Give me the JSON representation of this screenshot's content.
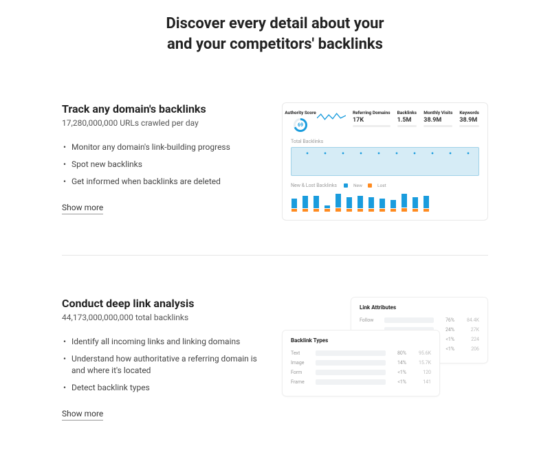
{
  "hero": {
    "line1": "Discover every detail about your",
    "line2": "and your competitors' backlinks"
  },
  "section1": {
    "title": "Track any domain's backlinks",
    "subtitle": "17,280,000,000 URLs crawled per day",
    "bullets": [
      "Monitor any domain's link-building progress",
      "Spot new backlinks",
      "Get informed when backlinks are deleted"
    ],
    "show_more": "Show more",
    "card": {
      "authority_label": "Authority Score",
      "authority_value": "69",
      "stats": [
        {
          "label": "Referring Domains",
          "value": "17K"
        },
        {
          "label": "Backlinks",
          "value": "1.5M"
        },
        {
          "label": "Monthly Visits",
          "value": "38.9M"
        },
        {
          "label": "Keywords",
          "value": "38.9M"
        }
      ],
      "total_label": "Total Backlinks",
      "newlost_label": "New & Lost Backlinks",
      "legend_new": "New",
      "legend_lost": "Lost"
    }
  },
  "section2": {
    "title": "Conduct deep link analysis",
    "subtitle": "44,173,000,000,000 total backlinks",
    "bullets": [
      "Identify all incoming links and linking domains",
      "Understand how authoritative a referring domain is and where it's located",
      "Detect backlink types"
    ],
    "show_more": "Show more",
    "link_attributes": {
      "title": "Link Attributes",
      "rows": [
        {
          "label": "Follow",
          "pct": "76%",
          "count": "84.4K",
          "fill": 76,
          "green": true
        },
        {
          "label": "",
          "pct": "24%",
          "count": "27K",
          "fill": 24
        },
        {
          "label": "",
          "pct": "<1%",
          "count": "224",
          "fill": 2
        },
        {
          "label": "",
          "pct": "<1%",
          "count": "206",
          "fill": 2
        }
      ]
    },
    "backlink_types": {
      "title": "Backlink Types",
      "rows": [
        {
          "label": "Text",
          "pct": "80%",
          "count": "95.6K",
          "fill": 80
        },
        {
          "label": "Image",
          "pct": "14%",
          "count": "15.7K",
          "fill": 14
        },
        {
          "label": "Form",
          "pct": "<1%",
          "count": "120",
          "fill": 3
        },
        {
          "label": "Frame",
          "pct": "<1%",
          "count": "141",
          "fill": 3
        }
      ]
    }
  },
  "chart_data": [
    {
      "type": "bar",
      "title": "New & Lost Backlinks",
      "series": [
        {
          "name": "New",
          "color": "#1a9cdd",
          "values": [
            14,
            18,
            18,
            4,
            20,
            16,
            18,
            16,
            14,
            12,
            20,
            16,
            18
          ]
        },
        {
          "name": "Lost",
          "color": "#ff8a1f",
          "values": [
            4,
            4,
            4,
            4,
            5,
            4,
            4,
            4,
            4,
            4,
            5,
            4,
            4
          ]
        }
      ]
    },
    {
      "type": "bar",
      "title": "Link Attributes",
      "categories": [
        "Follow",
        "",
        "",
        ""
      ],
      "series": [
        {
          "name": "percent",
          "values": [
            76,
            24,
            1,
            1
          ]
        },
        {
          "name": "count",
          "values": [
            84400,
            27000,
            224,
            206
          ]
        }
      ]
    },
    {
      "type": "bar",
      "title": "Backlink Types",
      "categories": [
        "Text",
        "Image",
        "Form",
        "Frame"
      ],
      "series": [
        {
          "name": "percent",
          "values": [
            80,
            14,
            1,
            1
          ]
        },
        {
          "name": "count",
          "values": [
            95600,
            15700,
            120,
            141
          ]
        }
      ]
    }
  ]
}
